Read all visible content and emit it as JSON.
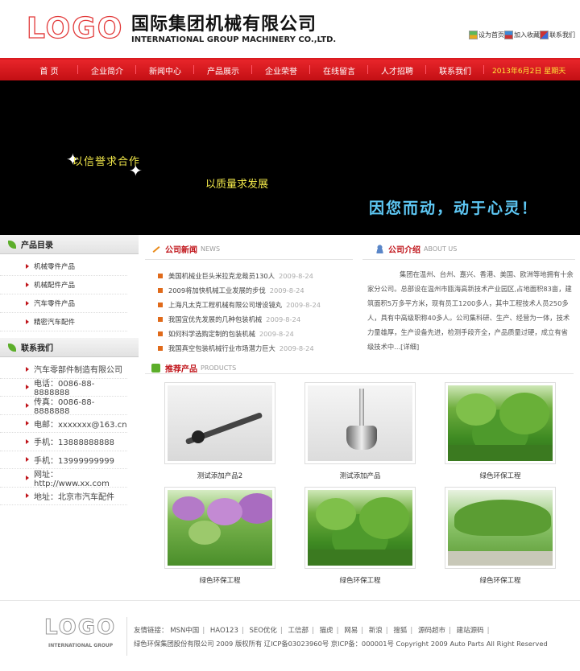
{
  "header": {
    "logo": "LOGO",
    "company_cn": "国际集团机械有限公司",
    "company_en": "INTERNATIONAL GROUP MACHINERY CO.,LTD.",
    "top_links": [
      "设为首页",
      "加入收藏",
      "联系我们"
    ]
  },
  "nav": {
    "items": [
      "首 页",
      "企业简介",
      "新闻中心",
      "产品展示",
      "企业荣誉",
      "在线留言",
      "人才招聘",
      "联系我们"
    ],
    "date": "2013年6月2日 星期天"
  },
  "banner": {
    "slogan1": "以信誉求合作",
    "slogan2": "以质量求发展",
    "slogan3": "因您而动，动于心灵！"
  },
  "sidebar": {
    "products_title": "产品目录",
    "products": [
      "机械零件产品",
      "机械配件产品",
      "汽车零件产品",
      "精密汽车配件"
    ],
    "contact_title": "联系我们",
    "contacts": [
      "汽车零部件制造有限公司",
      "电话：0086-88-8888888",
      "传真：0086-88-8888888",
      "电邮：xxxxxxx@163.cn",
      "手机：13888888888",
      "手机：13999999999",
      "网址：http://www.xx.com",
      "地址：北京市汽车配件"
    ]
  },
  "news": {
    "title": "公司新闻",
    "title_en": "NEWS",
    "items": [
      {
        "text": "美国机械业巨头米拉克龙裁员130人",
        "date": "2009-8-24"
      },
      {
        "text": "2009将加快机械工业发展的步伐",
        "date": "2009-8-24"
      },
      {
        "text": "上海凡太克工程机械有限公司增设镜丸",
        "date": "2009-8-24"
      },
      {
        "text": "我国宜优先发展的几种包装机械",
        "date": "2009-8-24"
      },
      {
        "text": "如何科学选购定制的包装机械",
        "date": "2009-8-24"
      },
      {
        "text": "我国真空包装机械行业市场潜力巨大",
        "date": "2009-8-24"
      }
    ]
  },
  "about": {
    "title": "公司介绍",
    "title_en": "ABOUT US",
    "text": "集团在温州、台州、嘉兴、香港、美国、欧洲等地拥有十余家分公司。总部设在温州市瓯海高新技术产业园区,占地面积83亩，建筑面积5万多平方米，现有员工1200多人，其中工程技术人员250多人，具有中高级职称40多人。公司集科研、生产、经营为一体，技术力量雄厚，生产设备先进，检测手段齐全，产品质量过硬，成立有省级技术中...",
    "more": "[详细]"
  },
  "products": {
    "title": "推荐产品",
    "title_en": "PRODUCTS",
    "items": [
      "测试添加产品2",
      "测试添加产品",
      "绿色环保工程",
      "绿色环保工程",
      "绿色环保工程",
      "绿色环保工程"
    ]
  },
  "footer": {
    "logo": "LOGO",
    "logo_sub": "INTERNATIONAL GROUP",
    "links_label": "友情链接：",
    "links": [
      "MSN中国",
      "HAO123",
      "SEO优化",
      "工信部",
      "猫虎",
      "网易",
      "新浪",
      "搜狐",
      "源码超市",
      "建站源码"
    ],
    "copyright": "绿色环保集团股份有限公司 2009 版权所有 辽ICP备03023960号 京ICP备：000001号 Copyright 2009 Auto Parts All Right Reserved"
  }
}
